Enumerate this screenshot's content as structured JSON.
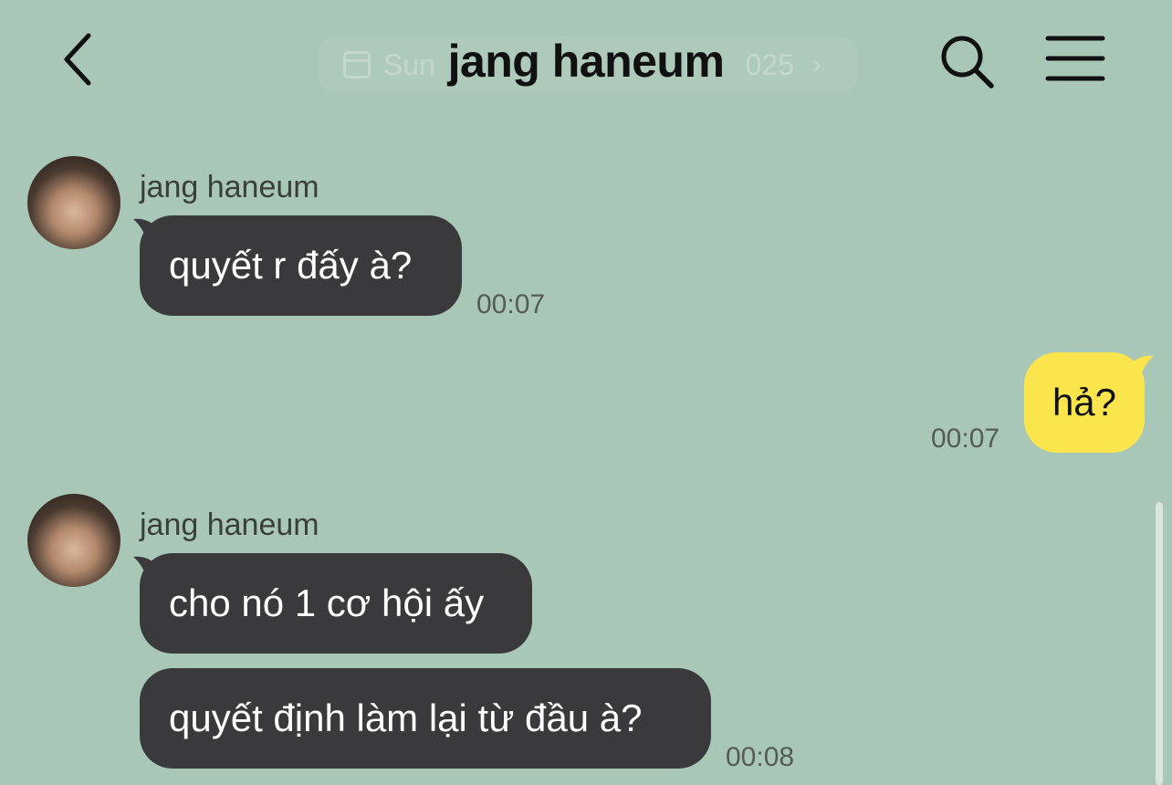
{
  "header": {
    "title": "jang haneum",
    "date_label": "Sun",
    "date_year_fragment": "025"
  },
  "messages": [
    {
      "sender": "jang haneum",
      "text": "quyết r đấy à?",
      "time": "00:07"
    },
    {
      "sender": "me",
      "text": "hả?",
      "time": "00:07"
    },
    {
      "sender": "jang haneum",
      "text": "cho nó 1 cơ hội ấy",
      "time": ""
    },
    {
      "sender": "jang haneum",
      "text": "quyết định làm lại từ đầu à?",
      "time": "00:08"
    }
  ],
  "colors": {
    "background": "#a8c7b6",
    "incoming_bubble": "#3a3a3c",
    "outgoing_bubble": "#fbe54d"
  },
  "icons": {
    "back": "chevron-left-icon",
    "search": "search-icon",
    "menu": "hamburger-menu-icon",
    "date": "calendar-icon"
  }
}
